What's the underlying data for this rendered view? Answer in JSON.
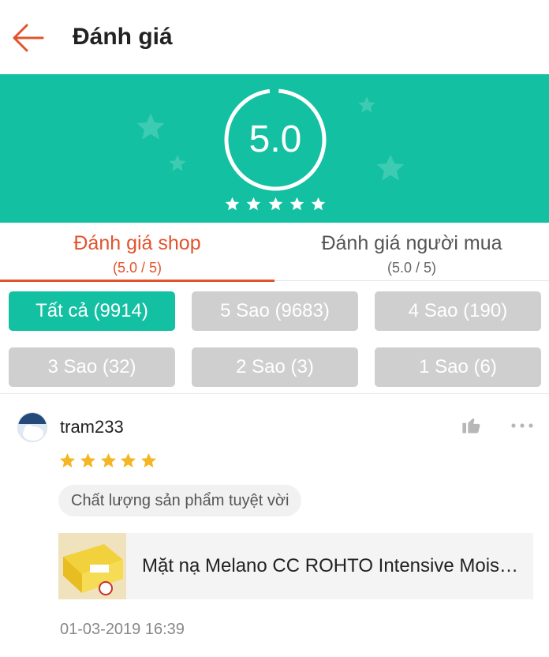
{
  "header": {
    "title": "Đánh giá",
    "back_icon": "arrow-left-icon"
  },
  "summary": {
    "score": "5.0",
    "stars": 5
  },
  "tabs": [
    {
      "label": "Đánh giá shop",
      "sub": "(5.0 / 5)",
      "active": true
    },
    {
      "label": "Đánh giá người mua",
      "sub": "(5.0 / 5)",
      "active": false
    }
  ],
  "filters": [
    {
      "label": "Tất cả (9914)",
      "active": true
    },
    {
      "label": "5 Sao (9683)",
      "active": false
    },
    {
      "label": "4 Sao (190)",
      "active": false
    },
    {
      "label": "3 Sao (32)",
      "active": false
    },
    {
      "label": "2 Sao (3)",
      "active": false
    },
    {
      "label": "1 Sao (6)",
      "active": false
    }
  ],
  "review": {
    "username": "tram233",
    "rating": 5,
    "tag": "Chất lượng sản phẩm tuyệt vời",
    "product_name": "Mặt nạ Melano CC ROHTO Intensive Moisture Mask",
    "date": "01-03-2019 16:39"
  },
  "colors": {
    "accent": "#13c0a2",
    "brand": "#e2532d",
    "star": "#f5b623",
    "chip_inactive": "#cfcfcf"
  }
}
